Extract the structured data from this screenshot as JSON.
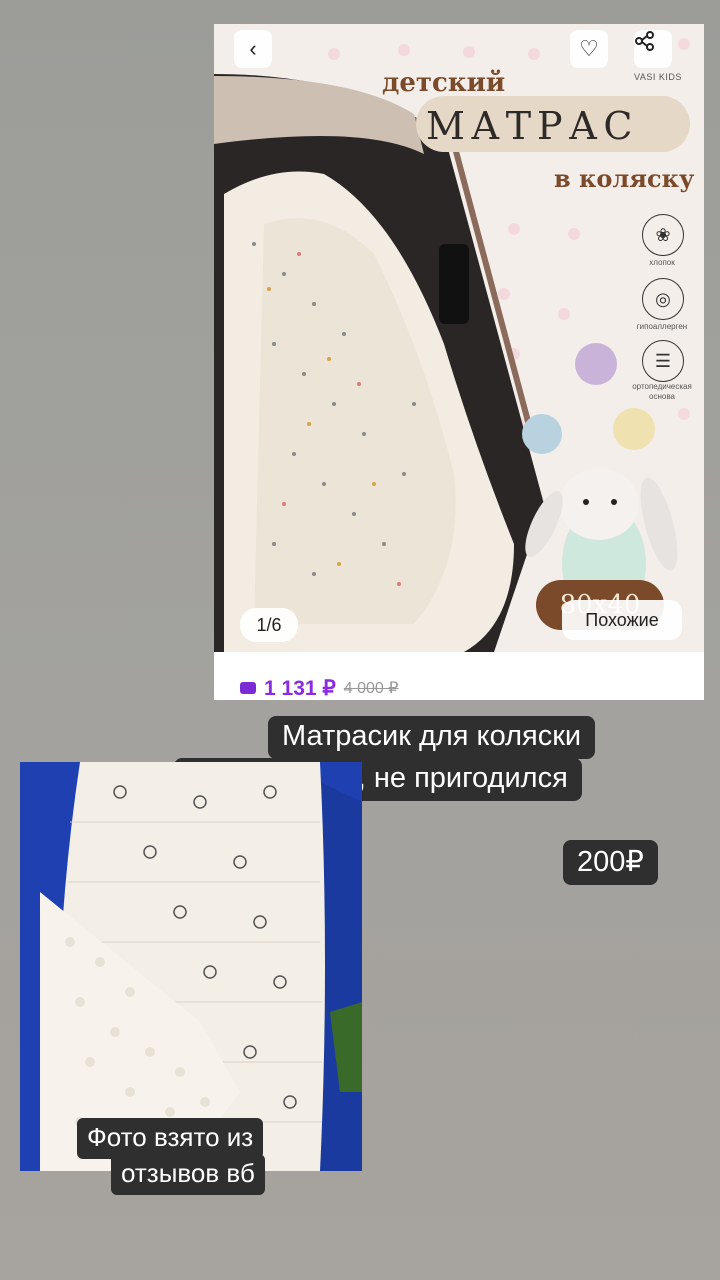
{
  "product_card": {
    "back_icon": "chevron-left-icon",
    "favorite_icon": "heart-icon",
    "share_icon": "share-icon",
    "brand": "VASI KIDS",
    "title_small": "детский",
    "title_main": "МАТРАС",
    "title_sub": "в коляску",
    "features": [
      {
        "icon": "cotton-icon",
        "label": "хлопок"
      },
      {
        "icon": "globe-leaf-icon",
        "label": "гипоаллерген"
      },
      {
        "icon": "mattress-layers-icon",
        "label": "ортопедическая основа"
      }
    ],
    "size_badge": "80x40",
    "photo_counter": "1/6",
    "similar_button": "Похожие",
    "price_current": "1 131 ₽",
    "price_old": "4 000 ₽",
    "colors": {
      "price_accent": "#8a2be2",
      "brand_brown": "#7a4a2a"
    }
  },
  "caption": {
    "line1": "Матрасик для коляски",
    "line2": "В  зип пакете, не пригодился",
    "price": "200₽"
  },
  "review_photo": {
    "caption_line1": "Фото взято из",
    "caption_line2": "отзывов вб"
  }
}
